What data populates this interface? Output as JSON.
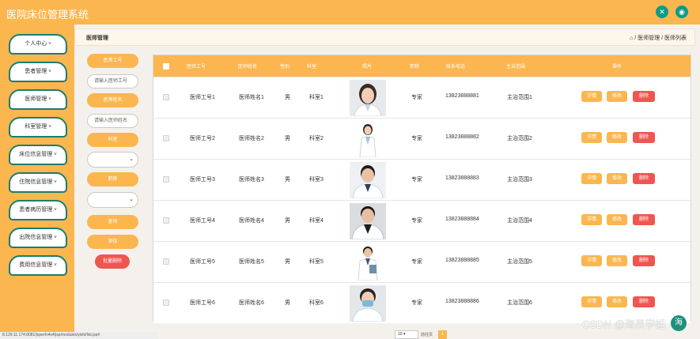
{
  "app": {
    "title": "医院床位管理系统"
  },
  "top_icons": [
    {
      "icon": "fullscreen-icon",
      "glyph": "✕"
    },
    {
      "icon": "user-icon",
      "glyph": "◉"
    }
  ],
  "sidebar": {
    "items": [
      {
        "label": "个人中心",
        "arrow": "˅"
      },
      {
        "label": "患者管理",
        "arrow": "˅"
      },
      {
        "label": "医师管理",
        "arrow": "˅"
      },
      {
        "label": "科室管理",
        "arrow": "˅"
      },
      {
        "label": "床位信息管理",
        "arrow": "˅"
      },
      {
        "label": "住院信息管理",
        "arrow": "˅"
      },
      {
        "label": "患者病历管理",
        "arrow": "˅"
      },
      {
        "label": "出院信息管理",
        "arrow": "˅"
      },
      {
        "label": "费用信息管理",
        "arrow": "˅"
      }
    ]
  },
  "header": {
    "page_title": "医师管理",
    "breadcrumb": "⌂ / 医师管理 / 医师列表"
  },
  "filters": {
    "id_label": "医师工号",
    "id_placeholder": "请输入医师工号",
    "name_label": "医师姓名",
    "name_placeholder": "请输入医师姓名",
    "dept_label": "科室",
    "title_label": "职称",
    "search_button": "查询",
    "add_button": "添加",
    "batch_delete_button": "批量删除"
  },
  "table": {
    "columns": [
      "医师工号",
      "医师姓名",
      "性别",
      "科室",
      "照片",
      "职称",
      "联系电话",
      "主治范围",
      "操作"
    ],
    "rows": [
      {
        "id": "医师工号1",
        "name": "医师姓名1",
        "gender": "男",
        "dept": "科室1",
        "title": "专家",
        "phone": "13823888881",
        "scope": "主治范围1"
      },
      {
        "id": "医师工号2",
        "name": "医师姓名2",
        "gender": "男",
        "dept": "科室2",
        "title": "专家",
        "phone": "13823888882",
        "scope": "主治范围2"
      },
      {
        "id": "医师工号3",
        "name": "医师姓名3",
        "gender": "男",
        "dept": "科室3",
        "title": "专家",
        "phone": "13823888883",
        "scope": "主治范围3"
      },
      {
        "id": "医师工号4",
        "name": "医师姓名4",
        "gender": "男",
        "dept": "科室4",
        "title": "专家",
        "phone": "13823888884",
        "scope": "主治范围4"
      },
      {
        "id": "医师工号5",
        "name": "医师姓名5",
        "gender": "男",
        "dept": "科室5",
        "title": "专家",
        "phone": "13823888885",
        "scope": "主治范围5"
      },
      {
        "id": "医师工号6",
        "name": "医师姓名6",
        "gender": "男",
        "dept": "科室6",
        "title": "专家",
        "phone": "13823888886",
        "scope": "主治范围6"
      }
    ],
    "actions": {
      "detail": "详情",
      "edit": "修改",
      "delete": "删除"
    }
  },
  "pagination": {
    "page_size": "10",
    "goto_text": "前往页",
    "current_page": "1"
  },
  "statusbar": {
    "url": "8.129.11.174:8081/jsperfn4x4/jsp/modules/yishi/list.jsp#"
  },
  "watermark": {
    "text": "CSDN @海灵学姐",
    "logo": "海"
  },
  "colors": {
    "primary": "#fbb64f",
    "danger": "#f0554f",
    "accent": "#1b7d6f"
  }
}
